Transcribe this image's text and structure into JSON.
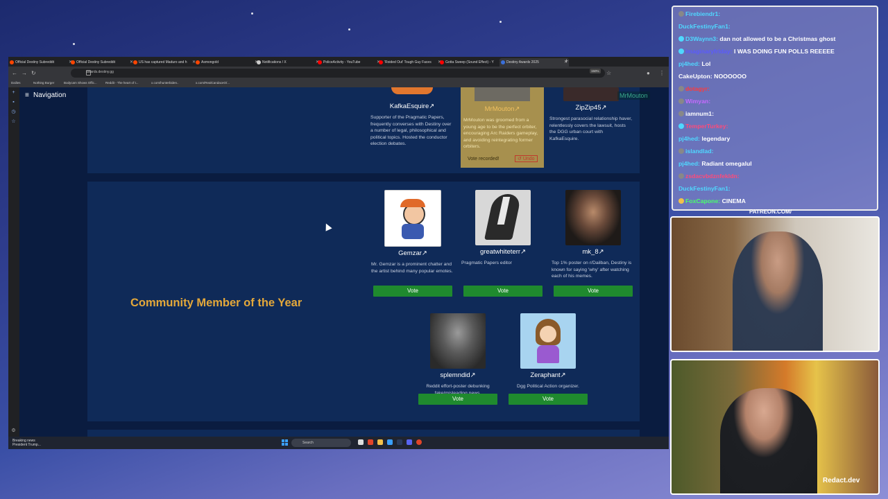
{
  "browser": {
    "tabs": [
      {
        "label": "Official Destiny Subreddit",
        "color": "#ff4500"
      },
      {
        "label": "Official Destiny Subreddit",
        "color": "#ff4500"
      },
      {
        "label": "US has captured Maduro and h",
        "color": "#ff4500"
      },
      {
        "label": "Asmongold",
        "color": "#ff4500"
      },
      {
        "label": "Notifications / X",
        "color": "#cccccc"
      },
      {
        "label": "PoliceActivity - YouTube",
        "color": "#ff0000"
      },
      {
        "label": "'Roided Out' Tough Guy Faces",
        "color": "#ff0000"
      },
      {
        "label": "Gotta Sweep (Sound Effect) - Y",
        "color": "#ff0000"
      },
      {
        "label": "Destiny Awards 2025",
        "color": "#3a6fd8",
        "active": true
      }
    ],
    "url": "awards.destiny.gg",
    "zoom": "150%",
    "bookmarks": [
      "Dailies",
      "Nothing Burger",
      "Bodycam Shows Offic...",
      "Reddit - The heart of t...",
      "x.com/hunterbiden..",
      "x.com/RealCandaceO/..."
    ]
  },
  "page": {
    "nav_label": "Navigation",
    "top_row": [
      {
        "name": "KafkaEsquire",
        "desc": "Supporter of the Pragmatic Papers, frequently converses with Destiny over a number of legal, philosophical and political topics. Hosted the conductor election debates."
      },
      {
        "name": "MrMouton",
        "desc": "MrMouton was groomed from a young age to be the perfect orbiter, encouraging Arc Raiders gameplay, and avoiding reintegrating former orbiters.",
        "selected": true,
        "status": "Vote recorded!",
        "undo": "Undo"
      },
      {
        "name": "ZipZip45",
        "desc": "Strongest parasocial relationship haver, relentlessly covers the lawsuit, hosts the DGG urban court with KafkaEsquire."
      }
    ],
    "floating_label": "MrMouton",
    "category_title": "Community Member of the Year",
    "nominees": [
      {
        "name": "Gemzar",
        "desc": "Mr. Gemzar is a prominent chatter and the artist behind many popular emotes.",
        "vote": "Vote"
      },
      {
        "name": "greatwhiteterr",
        "desc": "Pragmatic Papers editor",
        "vote": "Vote"
      },
      {
        "name": "mk_8",
        "desc": "Top 1% poster on r/Dailban, Destiny is known for saying 'why' after watching each of his memes.",
        "vote": "Vote"
      },
      {
        "name": "splemndid",
        "desc": "Reddit effort-poster debunking fake/misleading news.",
        "vote": "Vote"
      },
      {
        "name": "Zeraphant",
        "desc": "Dgg Political Action organizer.",
        "vote": "Vote"
      }
    ],
    "link_icon": "↗"
  },
  "taskbar": {
    "news_title": "Breaking news",
    "news_sub": "President Trump...",
    "search_placeholder": "Search"
  },
  "chat": [
    {
      "user": "Firebiendr1:",
      "msg": "",
      "color": "#4fd8ff"
    },
    {
      "user": "DuckFestinyFan1:",
      "msg": "",
      "color": "#4fd8ff"
    },
    {
      "user": "D3Waynn3:",
      "msg": "dan not allowed to be a Christmas ghost",
      "color": "#4fd8ff"
    },
    {
      "user": "imaginaryfriday:",
      "msg": "I WAS DOING FUN POLLS REEEEE",
      "color": "#5a5aff"
    },
    {
      "user": "pj4hed:",
      "msg": "Lol",
      "color": "#4fd8ff"
    },
    {
      "user": "CakeUpton:",
      "msg": "NOOOOOO",
      "color": "#ffffff"
    },
    {
      "user": "dotagyr:",
      "msg": "",
      "color": "#ff3a3a"
    },
    {
      "user": "Wimyan:",
      "msg": "",
      "color": "#c86aff"
    },
    {
      "user": "iamnum1:",
      "msg": "",
      "color": "#ffffff"
    },
    {
      "user": "TemperTurkey:",
      "msg": "",
      "color": "#ff4a7a"
    },
    {
      "user": "pj4hed:",
      "msg": "legendary",
      "color": "#4fd8ff"
    },
    {
      "user": "islandlad:",
      "msg": "",
      "color": "#4fd8ff"
    },
    {
      "user": "pj4hed:",
      "msg": "Radiant omegalul",
      "color": "#4fd8ff"
    },
    {
      "user": "zsdacvbdznfekldn:",
      "msg": "",
      "color": "#ff4a7a"
    },
    {
      "user": "DuckFestinyFan1:",
      "msg": "",
      "color": "#4fd8ff"
    },
    {
      "user": "FoxCapone:",
      "msg": "CINEMA",
      "color": "#4aff6a"
    }
  ],
  "overlay": {
    "patreon": "PATREON.COM/",
    "watermark": "Redact.dev"
  }
}
